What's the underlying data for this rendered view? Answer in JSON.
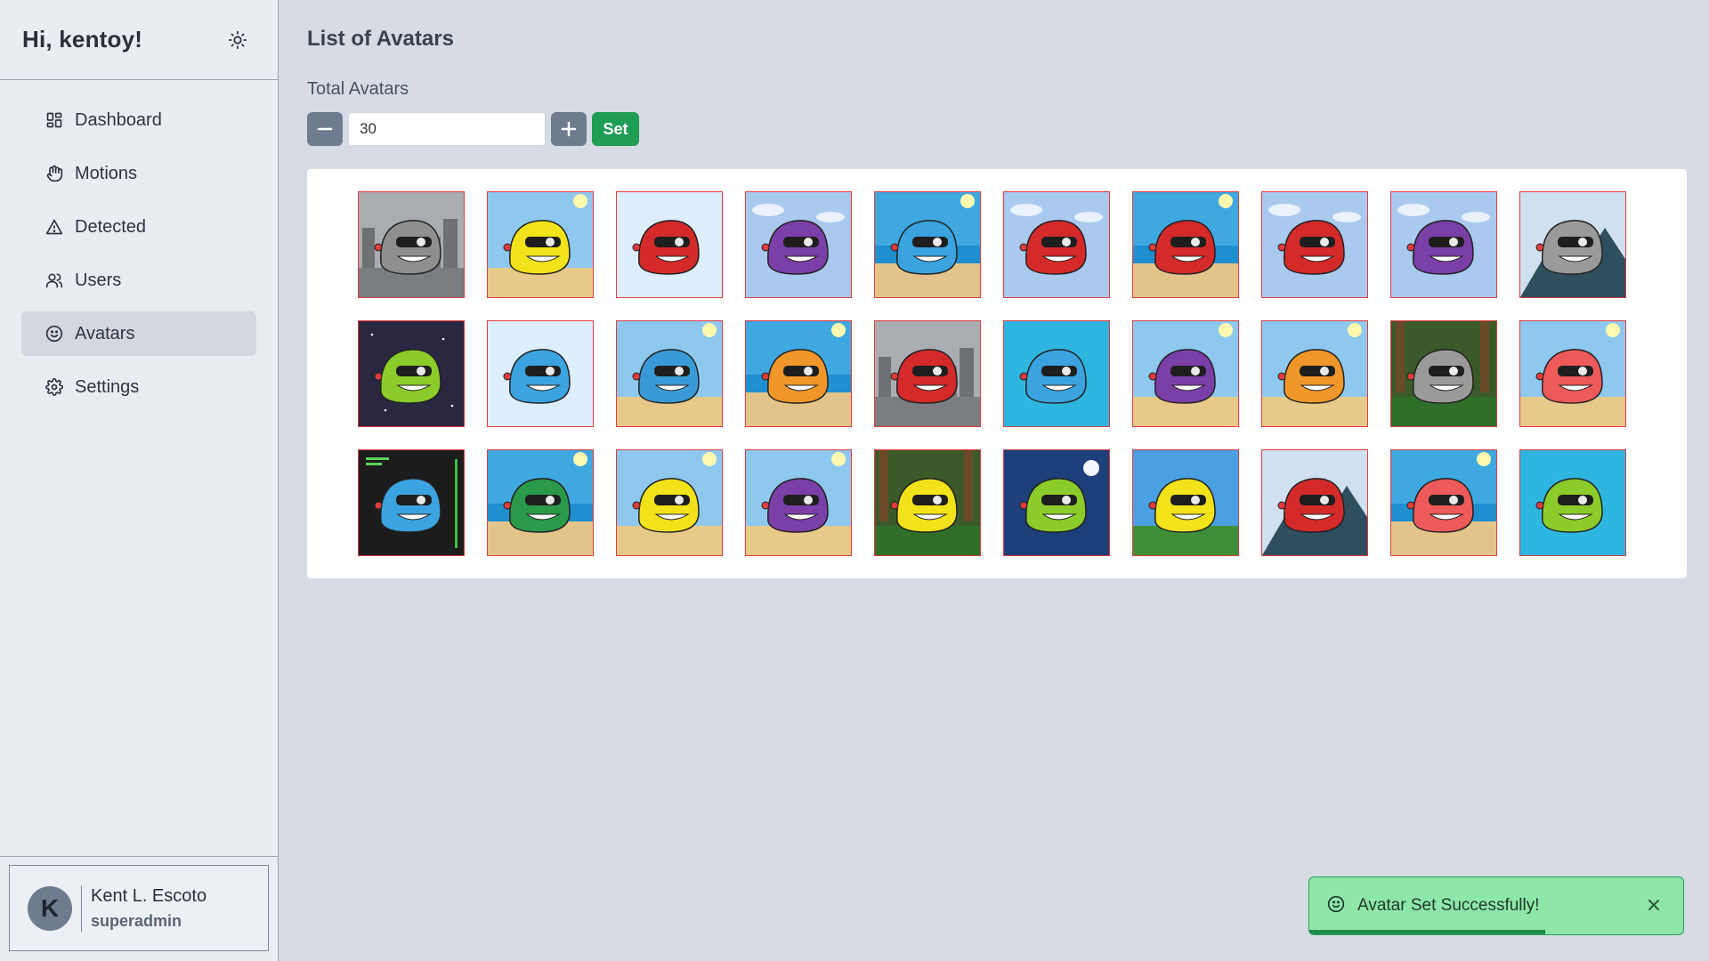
{
  "sidebar": {
    "greeting": "Hi, kentoy!",
    "theme_icon": "sun-icon",
    "items": [
      {
        "label": "Dashboard",
        "icon": "dashboard-grid-icon",
        "active": false
      },
      {
        "label": "Motions",
        "icon": "hand-icon",
        "active": false
      },
      {
        "label": "Detected",
        "icon": "warning-triangle-icon",
        "active": false
      },
      {
        "label": "Users",
        "icon": "users-icon",
        "active": false
      },
      {
        "label": "Avatars",
        "icon": "smiley-icon",
        "active": true
      },
      {
        "label": "Settings",
        "icon": "gear-icon",
        "active": false
      }
    ],
    "profile": {
      "initial": "K",
      "name": "Kent L. Escoto",
      "role": "superadmin"
    }
  },
  "main": {
    "title": "List of Avatars",
    "total_label": "Total Avatars",
    "total_value": "30",
    "set_label": "Set",
    "avatars": [
      {
        "bg": "city",
        "head": "#8f8f8f"
      },
      {
        "bg": "desert",
        "head": "#f2e21a"
      },
      {
        "bg": "plain",
        "head": "#d42a2a"
      },
      {
        "bg": "sky",
        "head": "#7b3fa8"
      },
      {
        "bg": "beach",
        "head": "#3aa3e0"
      },
      {
        "bg": "sky",
        "head": "#d42a2a"
      },
      {
        "bg": "beach",
        "head": "#d42a2a"
      },
      {
        "bg": "sky",
        "head": "#d42a2a"
      },
      {
        "bg": "sky",
        "head": "#7b3fa8"
      },
      {
        "bg": "mountain",
        "head": "#9a9a9a"
      },
      {
        "bg": "space",
        "head": "#8ccc2a"
      },
      {
        "bg": "plain",
        "head": "#3aa3e0"
      },
      {
        "bg": "desert",
        "head": "#3a9ad8"
      },
      {
        "bg": "beach",
        "head": "#f0962a"
      },
      {
        "bg": "city",
        "head": "#d42a2a"
      },
      {
        "bg": "ocean",
        "head": "#3aa3e0"
      },
      {
        "bg": "desert",
        "head": "#7b3fa8"
      },
      {
        "bg": "desert",
        "head": "#f0962a"
      },
      {
        "bg": "forest",
        "head": "#9a9a9a"
      },
      {
        "bg": "desert",
        "head": "#ee5a5a"
      },
      {
        "bg": "terminal",
        "head": "#3aa3e0"
      },
      {
        "bg": "beach",
        "head": "#2a9a4a"
      },
      {
        "bg": "desert",
        "head": "#f2e21a"
      },
      {
        "bg": "desert",
        "head": "#7b3fa8"
      },
      {
        "bg": "forest",
        "head": "#f2e21a"
      },
      {
        "bg": "night",
        "head": "#8ccc2a"
      },
      {
        "bg": "hill",
        "head": "#f2e21a"
      },
      {
        "bg": "mountain",
        "head": "#d42a2a"
      },
      {
        "bg": "beach",
        "head": "#ee5a5a"
      },
      {
        "bg": "ocean",
        "head": "#8ccc2a"
      }
    ]
  },
  "toast": {
    "message": "Avatar Set Successfully!",
    "icon": "smiley-icon",
    "progress": 0.63,
    "color": "#8ee6a9"
  },
  "colors": {
    "accent_green": "#1f9d55",
    "stepper_gray": "#6f7b8e",
    "tile_border": "#e03c3c"
  }
}
